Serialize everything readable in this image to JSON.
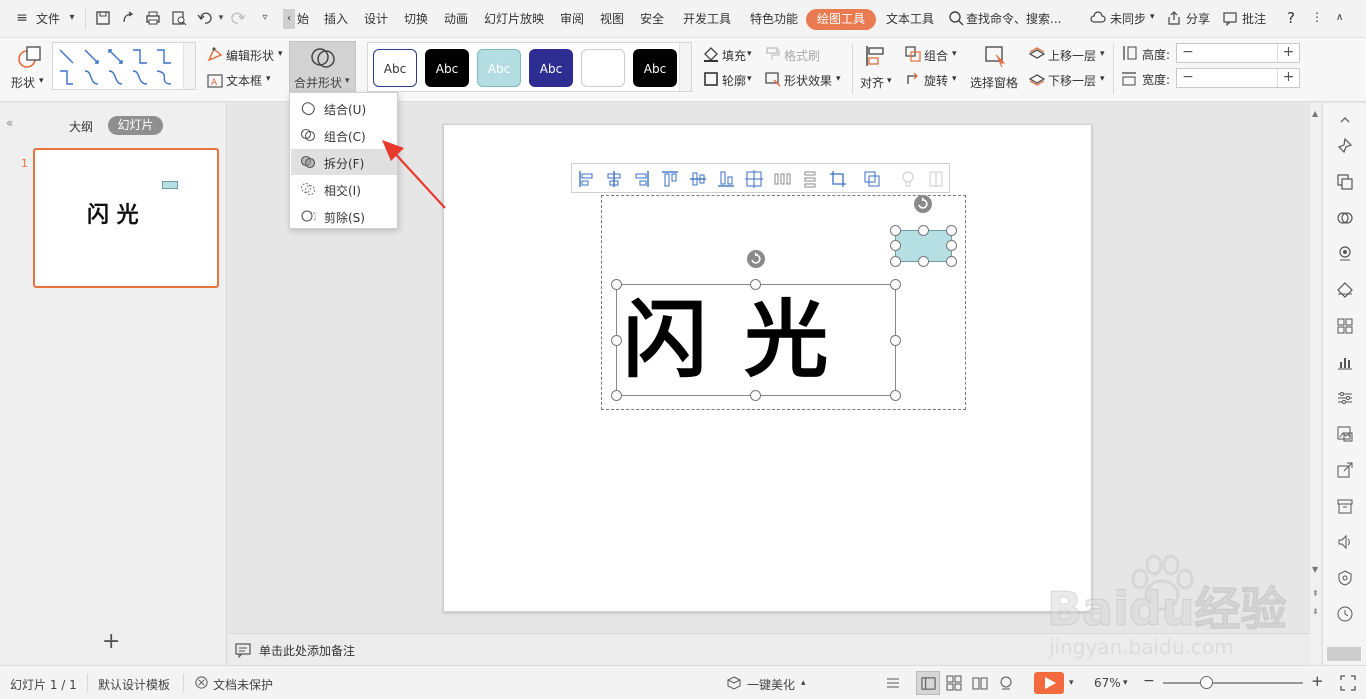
{
  "menubar": {
    "file_label": "文件",
    "tabs": [
      "始",
      "插入",
      "设计",
      "切换",
      "动画",
      "幻灯片放映",
      "审阅",
      "视图",
      "安全",
      "开发工具",
      "特色功能",
      "绘图工具",
      "文本工具"
    ],
    "active_tab": "绘图工具",
    "search_placeholder": "查找命令、搜索...",
    "sync_label": "未同步",
    "share_label": "分享",
    "comment_label": "批注",
    "help_label": "?"
  },
  "ribbon": {
    "shape_label": "形状",
    "edit_shape_label": "编辑形状",
    "textbox_label": "文本框",
    "merge_shapes_label": "合并形状",
    "style_swatches": [
      {
        "text": "Abc",
        "bg": "#ffffff",
        "fg": "#333333",
        "border": "#2c3b8f"
      },
      {
        "text": "Abc",
        "bg": "#000000",
        "fg": "#ffffff",
        "border": "#000000"
      },
      {
        "text": "Abc",
        "bg": "#b4dde1",
        "fg": "#ffffff",
        "border": "#7fb9c0"
      },
      {
        "text": "Abc",
        "bg": "#2d2d92",
        "fg": "#ffffff",
        "border": "#2d2d92"
      },
      {
        "text": "",
        "bg": "#ffffff",
        "fg": "#333333",
        "border": "#cccccc"
      },
      {
        "text": "Abc",
        "bg": "#000000",
        "fg": "#ffffff",
        "border": "#000000"
      }
    ],
    "fill_label": "填充",
    "format_painter_label": "格式刷",
    "outline_label": "轮廓",
    "shape_effects_label": "形状效果",
    "align_label": "对齐",
    "group_label": "组合",
    "rotate_label": "旋转",
    "selection_pane_label": "选择窗格",
    "bring_forward_label": "上移一层",
    "send_backward_label": "下移一层",
    "height_label": "高度:",
    "width_label": "宽度:",
    "height_value": "",
    "width_value": ""
  },
  "merge_menu": {
    "items": [
      {
        "label": "结合(U)",
        "highlighted": false
      },
      {
        "label": "组合(C)",
        "highlighted": false
      },
      {
        "label": "拆分(F)",
        "highlighted": true
      },
      {
        "label": "相交(I)",
        "highlighted": false
      },
      {
        "label": "剪除(S)",
        "highlighted": false
      }
    ]
  },
  "leftpane": {
    "outline_tab": "大纲",
    "slides_tab": "幻灯片",
    "slide_number": "1",
    "thumb_text": "闪 光",
    "add_slide": "+"
  },
  "slide": {
    "title_text": "闪 光",
    "rect_color": "#b5dfe2"
  },
  "notes": {
    "placeholder": "单击此处添加备注"
  },
  "statusbar": {
    "slide_counter": "幻灯片 1 / 1",
    "template": "默认设计模板",
    "protection": "文档未保护",
    "beautify": "一键美化",
    "zoom": "67%"
  },
  "watermark": {
    "brand": "Baidu经验",
    "url": "jingyan.baidu.com"
  },
  "colors": {
    "accent": "#ea7a52",
    "selection_border": "#e7733f",
    "play_button": "#f26a3d",
    "arrow_red": "#e8392f"
  }
}
